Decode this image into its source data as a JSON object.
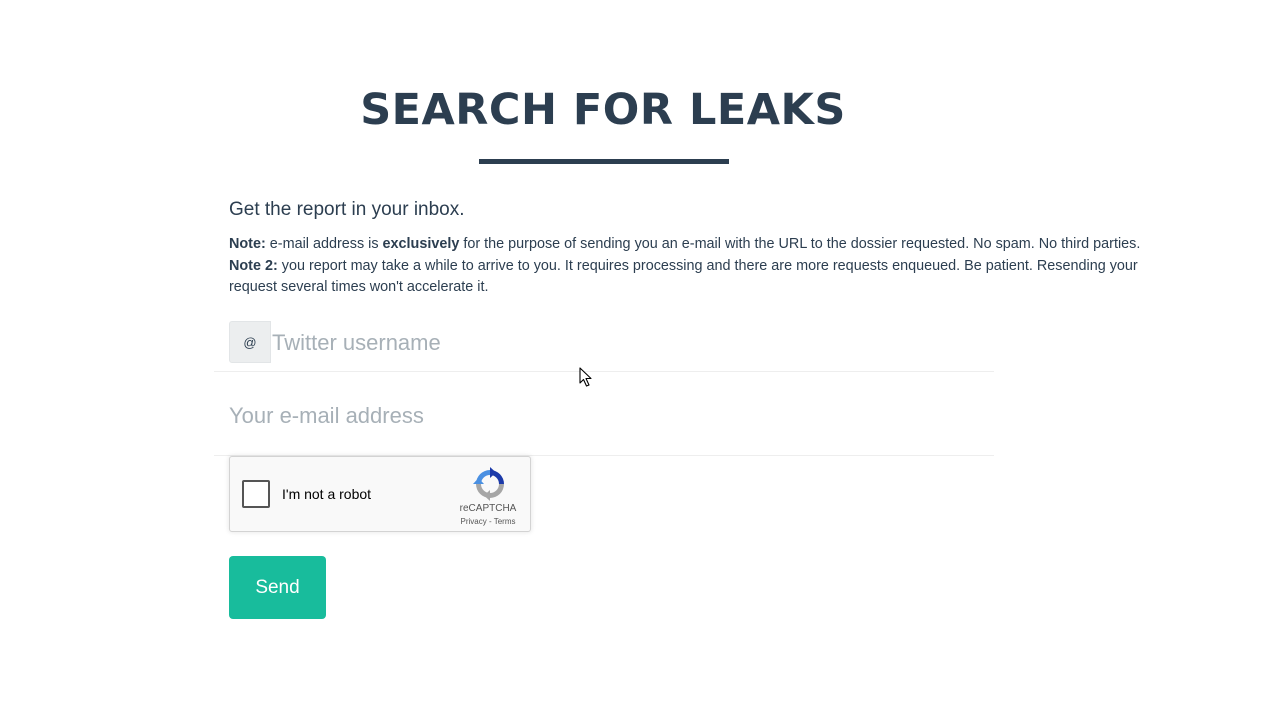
{
  "header": {
    "title": "SEARCH FOR LEAKS"
  },
  "intro": {
    "lead": "Get the report in your inbox.",
    "note1_label": "Note:",
    "note1_pre": " e-mail address is ",
    "note1_bold": "exclusively",
    "note1_post": " for the purpose of sending you an e-mail with the URL to the dossier requested. No spam. No third parties.",
    "note2_label": "Note 2:",
    "note2_text": " you report may take a while to arrive to you. It requires processing and there are more requests enqueued. Be patient. Resending your request several times won't accelerate it."
  },
  "form": {
    "twitter_addon": "@",
    "twitter_value": "",
    "twitter_placeholder": "Twitter username",
    "email_value": "",
    "email_placeholder": "Your e-mail address",
    "send_label": "Send"
  },
  "recaptcha": {
    "label": "I'm not a robot",
    "brand": "reCAPTCHA",
    "privacy": "Privacy",
    "separator": " - ",
    "terms": "Terms",
    "checked": false,
    "logo_icon": "recaptcha-logo-icon"
  },
  "colors": {
    "heading": "#2c3e50",
    "accent": "#18bc9c",
    "placeholder": "#a7b0b7"
  }
}
